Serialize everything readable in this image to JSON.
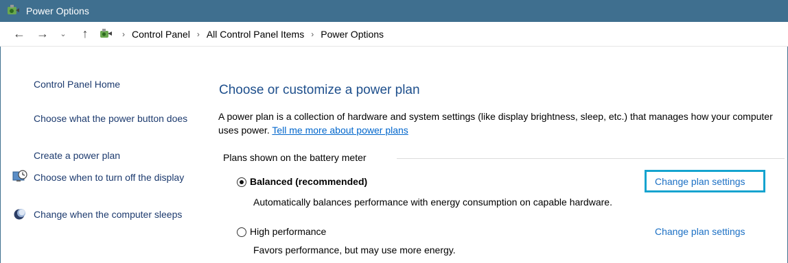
{
  "window": {
    "title": "Power Options",
    "icon": "power-options-icon"
  },
  "address_bar": {
    "nav": {
      "back": "back-arrow-icon",
      "forward": "forward-arrow-icon",
      "recent": "chevron-down-icon",
      "up": "up-arrow-icon"
    },
    "breadcrumbs": [
      "Control Panel",
      "All Control Panel Items",
      "Power Options"
    ]
  },
  "sidebar": {
    "items": [
      {
        "label": "Control Panel Home",
        "icon": ""
      },
      {
        "label": "Choose what the power button does",
        "icon": ""
      },
      {
        "label": "Create a power plan",
        "icon": ""
      },
      {
        "label": "Choose when to turn off the display",
        "icon": "monitor-clock-icon"
      },
      {
        "label": "Change when the computer sleeps",
        "icon": "moon-icon"
      }
    ]
  },
  "main": {
    "heading": "Choose or customize a power plan",
    "description": "A power plan is a collection of hardware and system settings (like display brightness, sleep, etc.) that manages how your computer uses power.",
    "learn_more_link": "Tell me more about power plans",
    "group_label": "Plans shown on the battery meter",
    "plans": [
      {
        "name": "Balanced (recommended)",
        "description": "Automatically balances performance with energy consumption on capable hardware.",
        "selected": true,
        "change_link": "Change plan settings"
      },
      {
        "name": "High performance",
        "description": "Favors performance, but may use more energy.",
        "selected": false,
        "change_link": "Change plan settings"
      }
    ]
  },
  "colors": {
    "titlebar": "#3f6f8f",
    "link": "#1a6fc4",
    "heading": "#1e4f8c",
    "highlight": "#14a3cf"
  }
}
